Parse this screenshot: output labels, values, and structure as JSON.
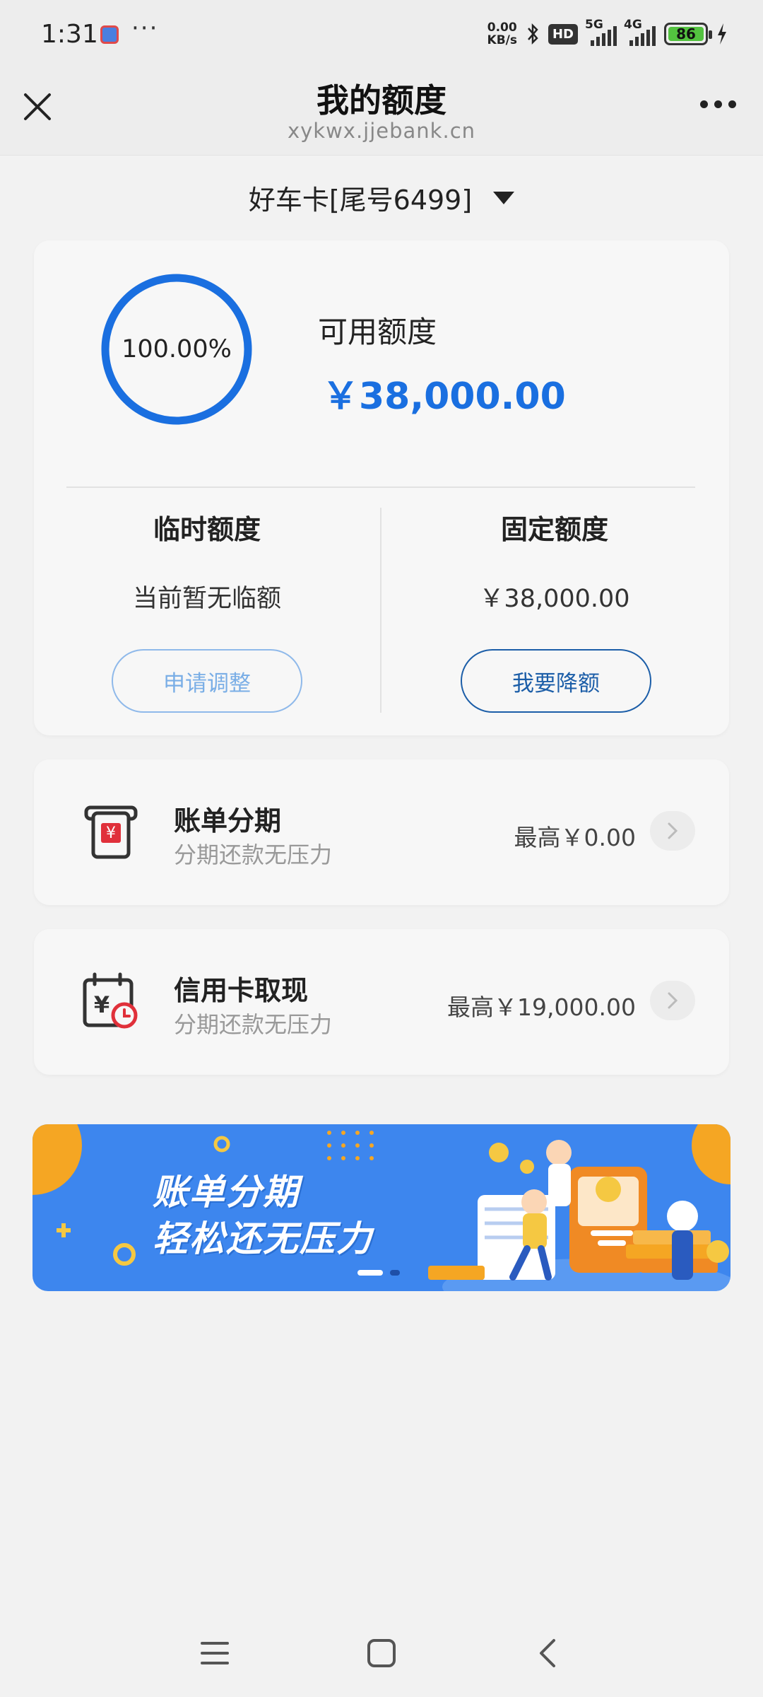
{
  "status_bar": {
    "time": "1:31",
    "speed_value": "0.00",
    "speed_unit": "KB/s",
    "hd_label": "HD",
    "net1": "5G",
    "net2": "4G",
    "battery": "86",
    "icons": [
      "app-notification-icon",
      "more-dots-icon",
      "bluetooth-icon",
      "signal-icon",
      "battery-icon",
      "charging-icon"
    ]
  },
  "header": {
    "title": "我的额度",
    "subtitle": "xykwx.jjebank.cn"
  },
  "card_selector": {
    "label": "好车卡[尾号6499]"
  },
  "limit": {
    "percent_label": "100.00%",
    "percent_value": 1.0,
    "available_label": "可用额度",
    "available_amount": "￥38,000.00",
    "temporary": {
      "title": "临时额度",
      "value": "当前暂无临额",
      "button": "申请调整"
    },
    "fixed": {
      "title": "固定额度",
      "value": "￥38,000.00",
      "button": "我要降额"
    }
  },
  "rows": [
    {
      "title": "账单分期",
      "subtitle": "分期还款无压力",
      "right": "最高￥0.00",
      "icon": "bill-installment-icon"
    },
    {
      "title": "信用卡取现",
      "subtitle": "分期还款无压力",
      "right": "最高￥19,000.00",
      "icon": "cash-withdraw-calendar-icon"
    }
  ],
  "banner": {
    "line1": "账单分期",
    "line2": "轻松还无压力"
  },
  "colors": {
    "accent": "#1a6fe0",
    "button_primary": "#1c5ea8",
    "button_disabled": "#7aaee6",
    "banner_bg": "#3d86ee",
    "icon_red": "#e0303a"
  }
}
